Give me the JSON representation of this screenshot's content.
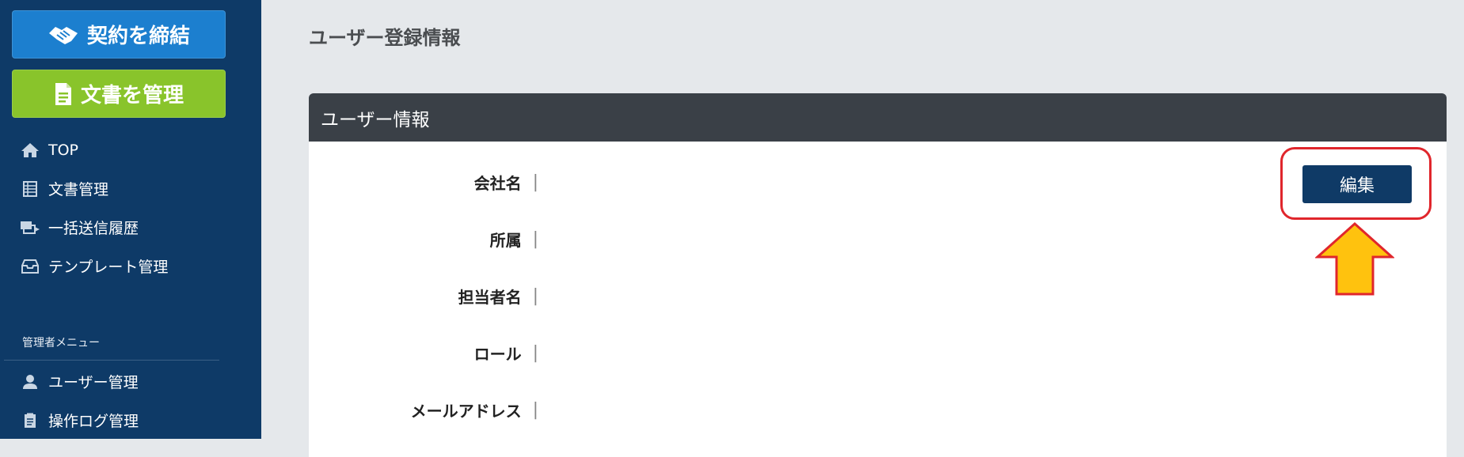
{
  "sidebar": {
    "contract_button": "契約を締結",
    "docs_button": "文書を管理",
    "nav": [
      {
        "label": "TOP",
        "icon": "home-icon"
      },
      {
        "label": "文書管理",
        "icon": "grid-doc-icon"
      },
      {
        "label": "一括送信履歴",
        "icon": "batch-send-icon"
      },
      {
        "label": "テンプレート管理",
        "icon": "template-box-icon"
      }
    ],
    "admin_heading": "管理者メニュー",
    "admin_nav": [
      {
        "label": "ユーザー管理",
        "icon": "user-icon"
      },
      {
        "label": "操作ログ管理",
        "icon": "log-doc-icon"
      }
    ]
  },
  "main": {
    "page_title": "ユーザー登録情報",
    "panel_title": "ユーザー情報",
    "edit_button": "編集",
    "fields": [
      {
        "label": "会社名",
        "sep": "|"
      },
      {
        "label": "所属",
        "sep": "|"
      },
      {
        "label": "担当者名",
        "sep": "|"
      },
      {
        "label": "ロール",
        "sep": "|"
      },
      {
        "label": "メールアドレス",
        "sep": "|"
      }
    ]
  },
  "colors": {
    "sidebar_bg": "#0e3a67",
    "contract_button": "#1c7fcf",
    "docs_button": "#89c42b",
    "panel_header": "#3a4047",
    "edit_button": "#0f3a66",
    "highlight_border": "#e0262c",
    "arrow_fill": "#ffc20e"
  }
}
